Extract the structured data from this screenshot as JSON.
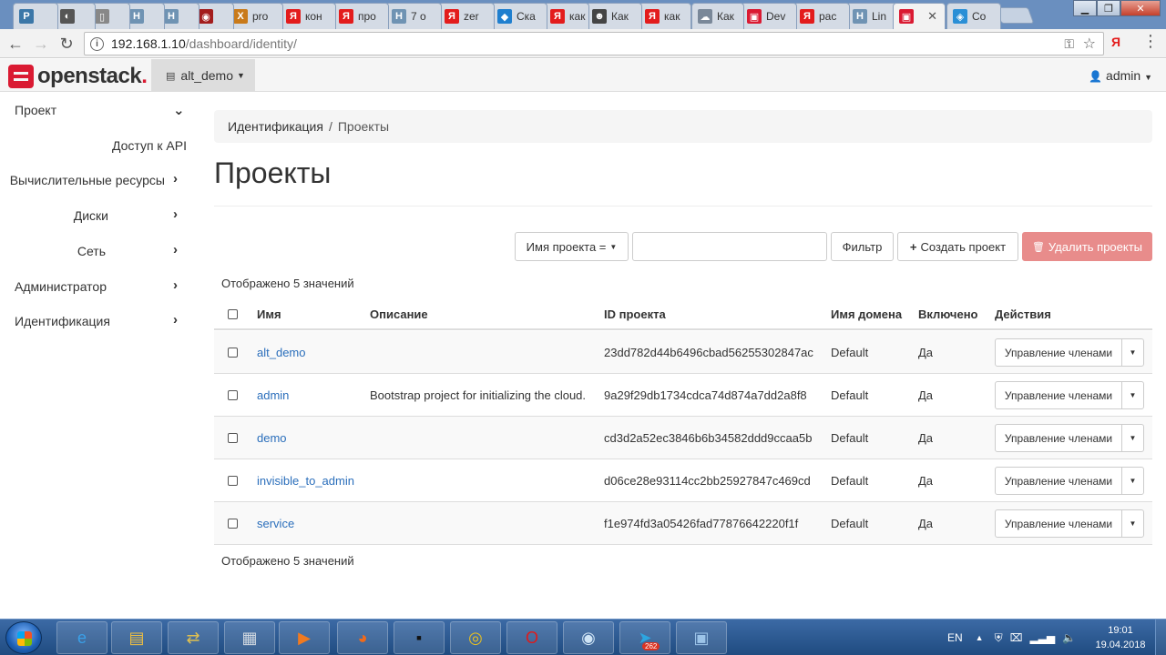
{
  "browser": {
    "tabs": [
      {
        "title": "",
        "favicon": "python-icon",
        "color": "#3b77a8",
        "glyph": "P"
      },
      {
        "title": "",
        "favicon": "shield-icon",
        "color": "#555555",
        "glyph": "◐"
      },
      {
        "title": "",
        "favicon": "document-icon",
        "color": "#888888",
        "glyph": "▯"
      },
      {
        "title": "",
        "favicon": "habr-icon",
        "color": "#6f93b3",
        "glyph": "H"
      },
      {
        "title": "",
        "favicon": "habr-icon",
        "color": "#6f93b3",
        "glyph": "H"
      },
      {
        "title": "",
        "favicon": "opera-icon",
        "color": "#a31d1d",
        "glyph": "◉"
      },
      {
        "title": "pro",
        "favicon": "x-icon",
        "color": "#c97a1a",
        "glyph": "X"
      },
      {
        "title": "кон",
        "favicon": "yandex-icon",
        "color": "#e31c1c",
        "glyph": "Я"
      },
      {
        "title": "про",
        "favicon": "yandex-icon",
        "color": "#e31c1c",
        "glyph": "Я"
      },
      {
        "title": "7 о",
        "favicon": "habr-icon",
        "color": "#6f93b3",
        "glyph": "H"
      },
      {
        "title": "zer",
        "favicon": "yandex-icon",
        "color": "#e31c1c",
        "glyph": "Я"
      },
      {
        "title": "Ска",
        "favicon": "app-icon",
        "color": "#1f7fcf",
        "glyph": "◆"
      },
      {
        "title": "как",
        "favicon": "yandex-icon",
        "color": "#e31c1c",
        "glyph": "Я"
      },
      {
        "title": "Как",
        "favicon": "users-icon",
        "color": "#444444",
        "glyph": "☻"
      },
      {
        "title": "как",
        "favicon": "yandex-icon",
        "color": "#e31c1c",
        "glyph": "Я"
      },
      {
        "title": "Как",
        "favicon": "cloud-icon",
        "color": "#7a8899",
        "glyph": "☁"
      },
      {
        "title": "Dev",
        "favicon": "openstack-icon",
        "color": "#da1a32",
        "glyph": "▣"
      },
      {
        "title": "рас",
        "favicon": "yandex-icon",
        "color": "#e31c1c",
        "glyph": "Я"
      },
      {
        "title": "Lin",
        "favicon": "habr-icon",
        "color": "#6f93b3",
        "glyph": "H"
      },
      {
        "title": "",
        "favicon": "openstack-icon",
        "color": "#da1a32",
        "glyph": "▣",
        "active": true
      },
      {
        "title": "Co",
        "favicon": "app-icon",
        "color": "#2a8fd6",
        "glyph": "◈"
      }
    ],
    "url_host": "192.168.1.10",
    "url_path": "/dashboard/identity/"
  },
  "header": {
    "logo_text": "openstack",
    "logo_dot": ".",
    "project": "alt_demo",
    "user": "admin"
  },
  "sidebar": {
    "items": [
      {
        "label": "Проект",
        "chevron": "down"
      },
      {
        "label": "Доступ к API",
        "chevron": ""
      },
      {
        "label": "Вычислительные ресурсы",
        "chevron": "right"
      },
      {
        "label": "Диски",
        "chevron": "right"
      },
      {
        "label": "Сеть",
        "chevron": "right"
      },
      {
        "label": "Администратор",
        "chevron": "right"
      },
      {
        "label": "Идентификация",
        "chevron": "right"
      }
    ]
  },
  "main": {
    "breadcrumb": {
      "root": "Идентификация",
      "separator": "/",
      "current": "Проекты"
    },
    "title": "Проекты",
    "filter_field": "Имя проекта =",
    "filter_value": "",
    "filter_button": "Фильтр",
    "create_button": "Создать проект",
    "delete_button": "Удалить проекты",
    "count_top": "Отображено 5 значений",
    "count_bottom": "Отображено 5 значений",
    "columns": [
      "Имя",
      "Описание",
      "ID проекта",
      "Имя домена",
      "Включено",
      "Действия"
    ],
    "rows": [
      {
        "name": "alt_demo",
        "description": "",
        "id": "23dd782d44b6496cbad56255302847ac",
        "domain": "Default",
        "enabled": "Да",
        "action": "Управление членами"
      },
      {
        "name": "admin",
        "description": "Bootstrap project for initializing the cloud.",
        "id": "9a29f29db1734cdca74d874a7dd2a8f8",
        "domain": "Default",
        "enabled": "Да",
        "action": "Управление членами"
      },
      {
        "name": "demo",
        "description": "",
        "id": "cd3d2a52ec3846b6b34582ddd9ccaa5b",
        "domain": "Default",
        "enabled": "Да",
        "action": "Управление членами"
      },
      {
        "name": "invisible_to_admin",
        "description": "",
        "id": "d06ce28e93114cc2bb25927847c469cd",
        "domain": "Default",
        "enabled": "Да",
        "action": "Управление членами"
      },
      {
        "name": "service",
        "description": "",
        "id": "f1e974fd3a05426fad77876642220f1f",
        "domain": "Default",
        "enabled": "Да",
        "action": "Управление членами"
      }
    ]
  },
  "taskbar": {
    "apps": [
      {
        "name": "ie-icon",
        "glyph": "e",
        "color": "#3aa0e8"
      },
      {
        "name": "explorer-icon",
        "glyph": "▤",
        "color": "#f0c040"
      },
      {
        "name": "network-icon",
        "glyph": "⇄",
        "color": "#e0c050"
      },
      {
        "name": "calculator-icon",
        "glyph": "▦",
        "color": "#d0d8e0"
      },
      {
        "name": "media-player-icon",
        "glyph": "▶",
        "color": "#f07a20"
      },
      {
        "name": "firefox-icon",
        "glyph": "◕",
        "color": "#f06a1a"
      },
      {
        "name": "terminal-icon",
        "glyph": "▪",
        "color": "#111111"
      },
      {
        "name": "chrome-icon",
        "glyph": "◎",
        "color": "#e8c020"
      },
      {
        "name": "opera-icon",
        "glyph": "O",
        "color": "#e01a1a"
      },
      {
        "name": "eye-icon",
        "glyph": "◉",
        "color": "#cfe4f5"
      },
      {
        "name": "telegram-icon",
        "glyph": "➤",
        "color": "#2ca5e0"
      },
      {
        "name": "window-icon",
        "glyph": "▣",
        "color": "#9cc4e8"
      }
    ],
    "telegram_badge": "262",
    "lang": "EN",
    "time": "19:01",
    "date": "19.04.2018"
  }
}
